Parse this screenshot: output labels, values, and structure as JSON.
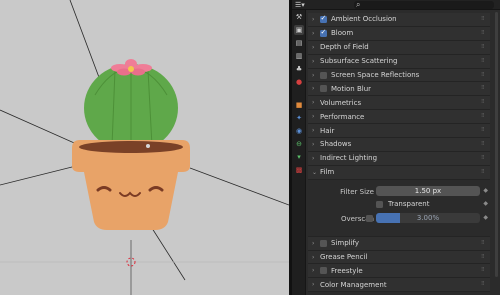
{
  "properties": {
    "panels_top": [
      {
        "label": "Ambient Occlusion",
        "checkbox": true,
        "checked": true
      },
      {
        "label": "Bloom",
        "checkbox": true,
        "checked": true
      },
      {
        "label": "Depth of Field",
        "checkbox": false
      },
      {
        "label": "Subsurface Scattering",
        "checkbox": false
      },
      {
        "label": "Screen Space Reflections",
        "checkbox": true,
        "checked": false
      },
      {
        "label": "Motion Blur",
        "checkbox": true,
        "checked": false
      },
      {
        "label": "Volumetrics",
        "checkbox": false
      },
      {
        "label": "Performance",
        "checkbox": false
      },
      {
        "label": "Hair",
        "checkbox": false
      },
      {
        "label": "Shadows",
        "checkbox": false
      },
      {
        "label": "Indirect Lighting",
        "checkbox": false
      }
    ],
    "film": {
      "label": "Film",
      "filter_size_label": "Filter Size",
      "filter_size_value": "1.50 px",
      "transparent_label": "Transparent",
      "overscan_label": "Overscan",
      "overscan_value": "3.00%"
    },
    "panels_bottom": [
      {
        "label": "Simplify",
        "checkbox": true,
        "checked": false
      },
      {
        "label": "Grease Pencil",
        "checkbox": false
      },
      {
        "label": "Freestyle",
        "checkbox": true,
        "checked": false
      },
      {
        "label": "Color Management",
        "checkbox": false
      }
    ]
  },
  "colors": {
    "viewport_bg": "#c9c9c9",
    "pot": "#e8a368",
    "cactus": "#5fa84a",
    "flower": "#ef7d97",
    "accent_blue": "#4772b3"
  },
  "tab_icons": [
    "tool-icon",
    "render-icon",
    "output-icon",
    "view-layer-icon",
    "scene-icon",
    "world-icon",
    "object-icon",
    "modifier-icon",
    "particles-icon",
    "physics-icon",
    "constraints-icon",
    "data-icon",
    "material-icon"
  ]
}
